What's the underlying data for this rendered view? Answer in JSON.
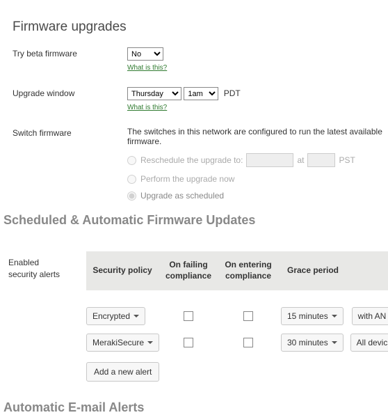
{
  "titles": {
    "page": "Firmware upgrades",
    "section_updates": "Scheduled & Automatic Firmware Updates",
    "section_email": "Automatic E-mail Alerts"
  },
  "firmware": {
    "beta": {
      "label": "Try beta firmware",
      "value": "No",
      "help": "What is this?"
    },
    "window": {
      "label": "Upgrade window",
      "day": "Thursday",
      "hour": "1am",
      "tz": "PDT",
      "help": "What is this?"
    },
    "switch": {
      "label": "Switch firmware",
      "info": "The switches in this network are configured to run the latest available firmware.",
      "opt_reschedule": "Reschedule the upgrade to:",
      "at": "at",
      "tz": "PST",
      "opt_now": "Perform the upgrade now",
      "opt_scheduled": "Upgrade as scheduled"
    }
  },
  "alerts": {
    "label_line1": "Enabled",
    "label_line2": "security alerts",
    "headers": {
      "policy": "Security policy",
      "fail": "On failing compliance",
      "enter": "On entering compliance",
      "grace": "Grace period"
    },
    "rows": [
      {
        "policy": "Encrypted",
        "grace": "15 minutes",
        "with": "with AN"
      },
      {
        "policy": "MerakiSecure",
        "grace": "30 minutes",
        "with": "All devic"
      }
    ],
    "add": "Add a new alert"
  }
}
